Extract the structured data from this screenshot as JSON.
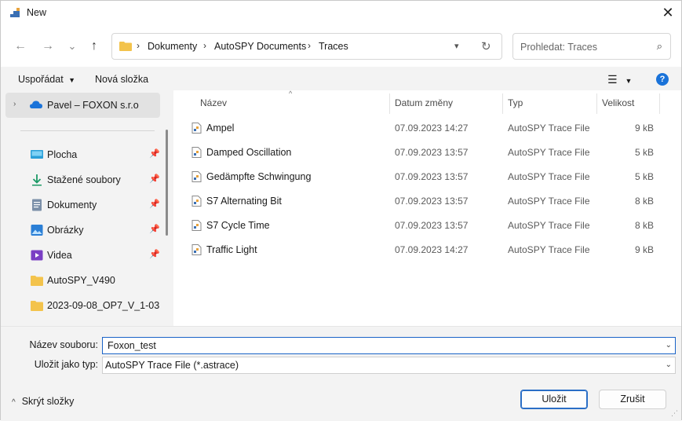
{
  "window": {
    "title": "New",
    "close_label": "✕"
  },
  "nav": {
    "back_glyph": "←",
    "forward_glyph": "→",
    "recent_glyph": "⌄",
    "up_glyph": "↑",
    "breadcrumb": [
      "Dokumenty",
      "AutoSPY Documents",
      "Traces"
    ],
    "search_placeholder": "Prohledat: Traces"
  },
  "toolbar": {
    "organize_label": "Uspořádat",
    "new_folder_label": "Nová složka",
    "help_label": "?"
  },
  "sidebar": {
    "top_item": "Pavel – FOXON s.r.o",
    "items": [
      {
        "label": "Plocha",
        "icon": "desktop-icon",
        "pinned": true
      },
      {
        "label": "Stažené soubory",
        "icon": "download-icon",
        "pinned": true
      },
      {
        "label": "Dokumenty",
        "icon": "documents-icon",
        "pinned": true
      },
      {
        "label": "Obrázky",
        "icon": "pictures-icon",
        "pinned": true
      },
      {
        "label": "Videa",
        "icon": "videos-icon",
        "pinned": true
      },
      {
        "label": "AutoSPY_V490",
        "icon": "folder-icon",
        "pinned": false
      },
      {
        "label": "2023-09-08_OP7_V_1-03",
        "icon": "folder-icon",
        "pinned": false
      }
    ]
  },
  "columns": {
    "name": "Název",
    "date": "Datum změny",
    "type": "Typ",
    "size": "Velikost"
  },
  "files": [
    {
      "name": "Ampel",
      "date": "07.09.2023 14:27",
      "type": "AutoSPY Trace File",
      "size": "9 kB"
    },
    {
      "name": "Damped Oscillation",
      "date": "07.09.2023 13:57",
      "type": "AutoSPY Trace File",
      "size": "5 kB"
    },
    {
      "name": "Gedämpfte Schwingung",
      "date": "07.09.2023 13:57",
      "type": "AutoSPY Trace File",
      "size": "5 kB"
    },
    {
      "name": "S7 Alternating Bit",
      "date": "07.09.2023 13:57",
      "type": "AutoSPY Trace File",
      "size": "8 kB"
    },
    {
      "name": "S7 Cycle Time",
      "date": "07.09.2023 13:57",
      "type": "AutoSPY Trace File",
      "size": "8 kB"
    },
    {
      "name": "Traffic Light",
      "date": "07.09.2023 14:27",
      "type": "AutoSPY Trace File",
      "size": "9 kB"
    }
  ],
  "form": {
    "filename_label": "Název souboru:",
    "filename_value": "Foxon_test",
    "filetype_label": "Uložit jako typ:",
    "filetype_value": "AutoSPY Trace File (*.astrace)"
  },
  "footer": {
    "hide_folders_label": "Skrýt složky",
    "save_label": "Uložit",
    "cancel_label": "Zrušit"
  },
  "colors": {
    "accent": "#1a63c7",
    "help": "#1a73d9",
    "folder": "#f3c34c"
  }
}
